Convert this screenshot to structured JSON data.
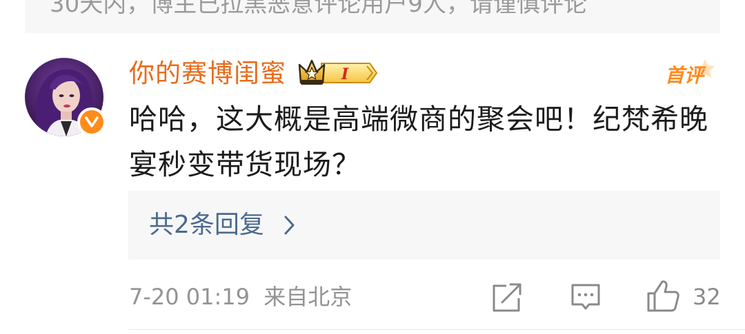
{
  "notice": {
    "text": "30天内，博主已拉黑恶意评论用户9人，请谨慎评论"
  },
  "comment": {
    "username": "你的赛博闺蜜",
    "vip_level": "I",
    "first_comment_tag": "首评",
    "text": "哈哈，这大概是高端微商的聚会吧！纪梵希晚宴秒变带货现场？",
    "replies_label": "共2条回复",
    "timestamp": "7-20 01:19",
    "location": "来自北京",
    "like_count": "32"
  },
  "colors": {
    "username": "#e86b1c",
    "link": "#4b6a8f",
    "verified_badge": "#ff8c1a",
    "meta": "#939393"
  },
  "icons": {
    "verified": "verified-v-icon",
    "vip": "crown-vip-icon",
    "share": "share-icon",
    "comment": "comment-icon",
    "like": "thumbs-up-icon",
    "chevron": "chevron-right-icon"
  }
}
